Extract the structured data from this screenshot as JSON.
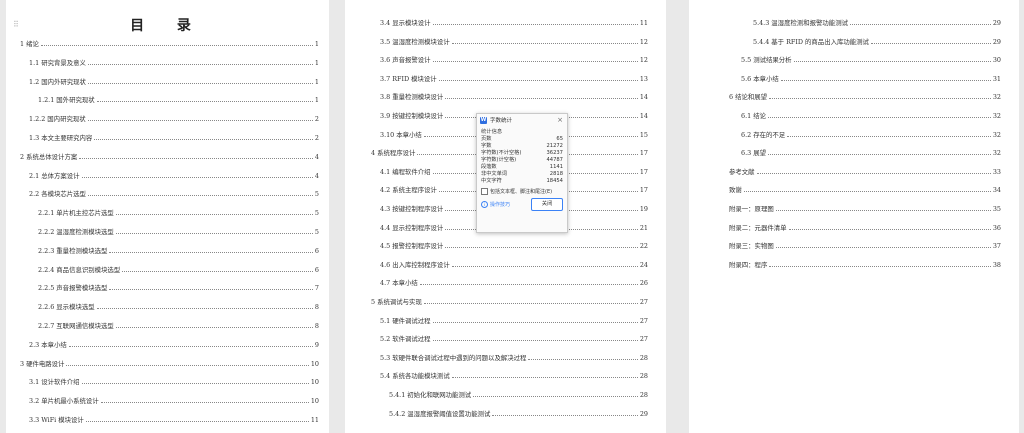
{
  "doc": {
    "toc_title": "目 录",
    "grip_icon": "⠿",
    "page1": [
      {
        "t": "1 绪论",
        "n": "1",
        "lv": 0
      },
      {
        "t": "1.1 研究背景及意义",
        "n": "1",
        "lv": 1
      },
      {
        "t": "1.2 国内外研究现状",
        "n": "1",
        "lv": 1
      },
      {
        "t": "1.2.1 国外研究现状",
        "n": "1",
        "lv": 2
      },
      {
        "t": "1.2.2 国内研究现状",
        "n": "2",
        "lv": 1
      },
      {
        "t": "1.3 本文主要研究内容",
        "n": "2",
        "lv": 1
      },
      {
        "t": "2 系统总体设计方案",
        "n": "4",
        "lv": 0
      },
      {
        "t": "2.1 总体方案设计",
        "n": "4",
        "lv": 1
      },
      {
        "t": "2.2 各模块芯片选型",
        "n": "5",
        "lv": 1
      },
      {
        "t": "2.2.1 单片机主控芯片选型",
        "n": "5",
        "lv": 2
      },
      {
        "t": "2.2.2 温湿度检测模块选型",
        "n": "5",
        "lv": 2
      },
      {
        "t": "2.2.3 重量检测模块选型",
        "n": "6",
        "lv": 2
      },
      {
        "t": "2.2.4 商品信息识别模块选型",
        "n": "6",
        "lv": 2
      },
      {
        "t": "2.2.5 声音报警模块选型",
        "n": "7",
        "lv": 2
      },
      {
        "t": "2.2.6 显示模块选型",
        "n": "8",
        "lv": 2
      },
      {
        "t": "2.2.7 互联网通信模块选型",
        "n": "8",
        "lv": 2
      },
      {
        "t": "2.3 本章小结",
        "n": "9",
        "lv": 1
      },
      {
        "t": "3 硬件电路设计",
        "n": "10",
        "lv": 0
      },
      {
        "t": "3.1 设计软件介绍",
        "n": "10",
        "lv": 1
      },
      {
        "t": "3.2 单片机最小系统设计",
        "n": "10",
        "lv": 1
      },
      {
        "t": "3.3 WiFi 模块设计",
        "n": "11",
        "lv": 1
      }
    ],
    "page2": [
      {
        "t": "3.4 显示模块设计",
        "n": "11",
        "lv": 1
      },
      {
        "t": "3.5 温湿度检测模块设计",
        "n": "12",
        "lv": 1
      },
      {
        "t": "3.6 声音报警设计",
        "n": "12",
        "lv": 1
      },
      {
        "t": "3.7 RFID 模块设计",
        "n": "13",
        "lv": 1
      },
      {
        "t": "3.8 重量检测模块设计",
        "n": "14",
        "lv": 1
      },
      {
        "t": "3.9 按键控制模块设计",
        "n": "14",
        "lv": 1
      },
      {
        "t": "3.10 本章小结",
        "n": "15",
        "lv": 1
      },
      {
        "t": "4 系统程序设计",
        "n": "17",
        "lv": 0
      },
      {
        "t": "4.1 编程软件介绍",
        "n": "17",
        "lv": 1
      },
      {
        "t": "4.2 系统主程序设计",
        "n": "17",
        "lv": 1
      },
      {
        "t": "4.3 按键控制程序设计",
        "n": "19",
        "lv": 1
      },
      {
        "t": "4.4 显示控制程序设计",
        "n": "21",
        "lv": 1
      },
      {
        "t": "4.5 报警控制程序设计",
        "n": "22",
        "lv": 1
      },
      {
        "t": "4.6 出入库控制程序设计",
        "n": "24",
        "lv": 1
      },
      {
        "t": "4.7 本章小结",
        "n": "26",
        "lv": 1
      },
      {
        "t": "5 系统调试与实现",
        "n": "27",
        "lv": 0
      },
      {
        "t": "5.1 硬件调试过程",
        "n": "27",
        "lv": 1
      },
      {
        "t": "5.2 软件调试过程",
        "n": "27",
        "lv": 1
      },
      {
        "t": "5.3 软硬件联合调试过程中遇到的问题以及解决过程",
        "n": "28",
        "lv": 1
      },
      {
        "t": "5.4 系统各功能模块测试",
        "n": "28",
        "lv": 1
      },
      {
        "t": "5.4.1 初始化和联网功能测试",
        "n": "28",
        "lv": 2
      },
      {
        "t": "5.4.2 温湿度报警阈值设置功能测试",
        "n": "29",
        "lv": 2
      }
    ],
    "page3": [
      {
        "t": "5.4.3 温湿度检测和报警功能测试",
        "n": "29",
        "lv": 2
      },
      {
        "t": "5.4.4 基于 RFID 的商品出入库功能测试",
        "n": "29",
        "lv": 2
      },
      {
        "t": "5.5 测试结果分析",
        "n": "30",
        "lv": 1
      },
      {
        "t": "5.6 本章小结",
        "n": "31",
        "lv": 1
      },
      {
        "t": "6 结论和展望",
        "n": "32",
        "lv": 0
      },
      {
        "t": "6.1 结论",
        "n": "32",
        "lv": 1
      },
      {
        "t": "6.2 存在的不足",
        "n": "32",
        "lv": 1
      },
      {
        "t": "6.3 展望",
        "n": "32",
        "lv": 1
      },
      {
        "t": "参考文献",
        "n": "33",
        "lv": 0
      },
      {
        "t": "致谢",
        "n": "34",
        "lv": 0
      },
      {
        "t": "附录一：原理图",
        "n": "35",
        "lv": 0
      },
      {
        "t": "附录二：元器件清单",
        "n": "36",
        "lv": 0
      },
      {
        "t": "附录三：实物图",
        "n": "37",
        "lv": 0
      },
      {
        "t": "附录四：程序",
        "n": "38",
        "lv": 0
      }
    ]
  },
  "dialog": {
    "app_icon": "W",
    "title": "字数统计",
    "close_icon": "×",
    "section": "统计信息",
    "stats": [
      {
        "label": "页数",
        "value": "65"
      },
      {
        "label": "字数",
        "value": "21272"
      },
      {
        "label": "字符数(不计空格)",
        "value": "36237"
      },
      {
        "label": "字符数(计空格)",
        "value": "44787"
      },
      {
        "label": "段落数",
        "value": "1141"
      },
      {
        "label": "非中文单词",
        "value": "2818"
      },
      {
        "label": "中文字符",
        "value": "18454"
      }
    ],
    "option_label": "包括文本框、脚注和尾注(E)",
    "tips_label": "操作技巧",
    "close_button": "关闭"
  },
  "colors": {
    "accent": "#3b82f6",
    "page": "#ffffff",
    "background": "#e9e9e9"
  }
}
